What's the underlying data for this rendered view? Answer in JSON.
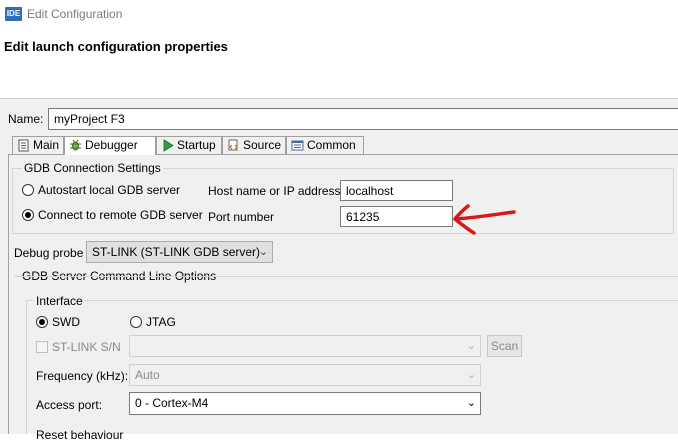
{
  "window": {
    "title": "Edit Configuration",
    "app_icon_text": "IDE"
  },
  "header": {
    "title": "Edit launch configuration properties"
  },
  "name_field": {
    "label": "Name:",
    "value": "myProject F3"
  },
  "tabs": [
    {
      "label": "Main",
      "icon": "main-icon"
    },
    {
      "label": "Debugger",
      "icon": "bug-icon"
    },
    {
      "label": "Startup",
      "icon": "play-icon"
    },
    {
      "label": "Source",
      "icon": "source-icon"
    },
    {
      "label": "Common",
      "icon": "common-icon"
    }
  ],
  "gdb_connection": {
    "group_label": "GDB Connection Settings",
    "autostart_label": "Autostart local GDB server",
    "remote_label": "Connect to remote GDB server",
    "host_label": "Host name or IP address",
    "host_value": "localhost",
    "port_label": "Port number",
    "port_value": "61235"
  },
  "debug_probe": {
    "label": "Debug probe",
    "value": "ST-LINK (ST-LINK GDB server)"
  },
  "server_options": {
    "group_label": "GDB Server Command Line Options",
    "interface_label": "Interface",
    "swd_label": "SWD",
    "jtag_label": "JTAG",
    "stlink_sn_label": "ST-LINK S/N",
    "scan_label": "Scan",
    "frequency_label": "Frequency (kHz):",
    "frequency_value": "Auto",
    "access_port_label": "Access port:",
    "access_port_value": "0 - Cortex-M4",
    "reset_behaviour_label": "Reset behaviour"
  },
  "colors": {
    "annotation_arrow": "#d7191c",
    "app_icon": "#2f6fb5"
  }
}
